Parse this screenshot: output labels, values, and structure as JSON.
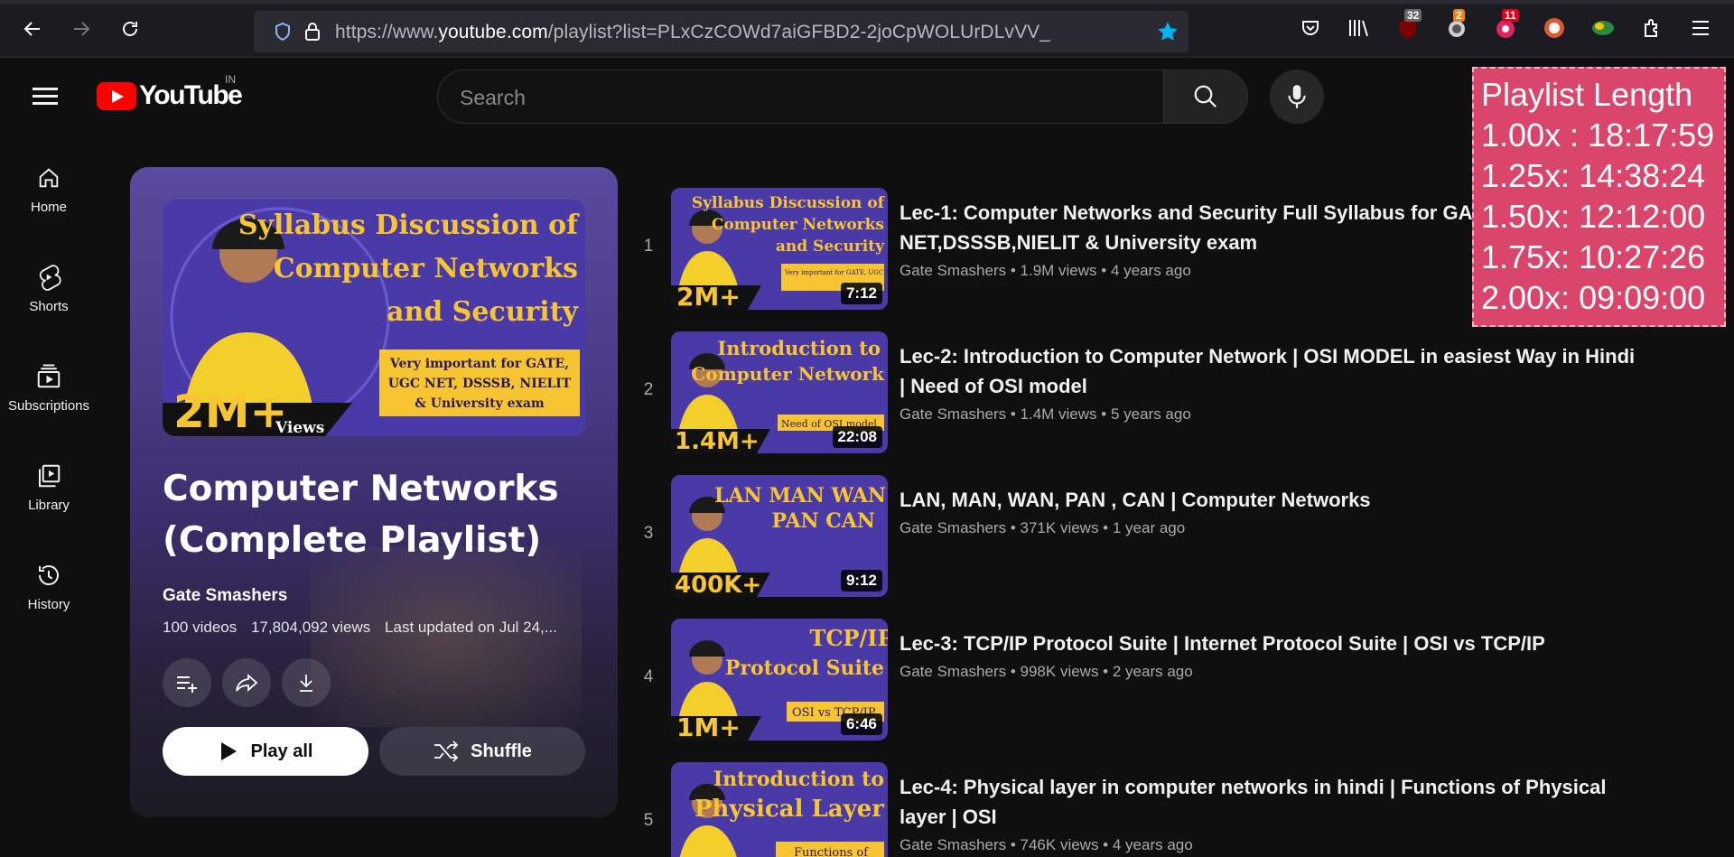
{
  "browser": {
    "url_prefix": "https://www.",
    "url_host": "youtube.com",
    "url_path": "/playlist?list=PLxCzCOWd7aiGFBD2-2joCpWOLUrDLvVV_",
    "badges": [
      "32",
      "2",
      "11"
    ]
  },
  "header": {
    "logo_text": "YouTube",
    "country": "IN",
    "search_placeholder": "Search"
  },
  "playlist_length": {
    "title": "Playlist Length",
    "rows": [
      "1.00x : 18:17:59",
      "1.25x: 14:38:24",
      "1.50x: 12:12:00",
      "1.75x: 10:27:26",
      "2.00x: 09:09:00"
    ]
  },
  "guide": [
    {
      "label": "Home",
      "icon": "home-icon"
    },
    {
      "label": "Shorts",
      "icon": "shorts-icon"
    },
    {
      "label": "Subscriptions",
      "icon": "subscriptions-icon"
    },
    {
      "label": "Library",
      "icon": "library-icon"
    },
    {
      "label": "History",
      "icon": "history-icon"
    }
  ],
  "playlist": {
    "thumb": {
      "line1": "Syllabus Discussion of",
      "line2": "Computer Networks",
      "line3": "and Security",
      "box": [
        "Very important for GATE,",
        "UGC NET, DSSSB, NIELIT",
        "& University exam"
      ],
      "views_big": "2M+",
      "views_small": "Views"
    },
    "title": "Computer Networks (Complete Playlist)",
    "channel": "Gate Smashers",
    "videos": "100 videos",
    "views": "17,804,092 views",
    "updated": "Last updated on Jul 24,...",
    "play_all": "Play all",
    "shuffle": "Shuffle"
  },
  "videos": [
    {
      "index": "1",
      "title": "Lec-1: Computer Networks and Security Full Syllabus for GA... NET,DSSSB,NIELIT & University exam",
      "title_l1": "Lec-1: Computer Networks and Security Full Syllabus for GA",
      "title_l2": "NET,DSSSB,NIELIT & University exam",
      "channel": "Gate Smashers",
      "views": "1.9M views",
      "age": "4 years ago",
      "duration": "7:12",
      "thumb_lines": [
        "Syllabus Discussion of",
        "Computer Networks",
        "and Security"
      ],
      "thumb_box": "Very important for GATE, UGC NET, DSSSB, NIELIT & Univ...",
      "thumb_views": "2M+"
    },
    {
      "index": "2",
      "title_l1": "Lec-2: Introduction to Computer Network | OSI MODEL in easiest Way in Hindi",
      "title_l2": "| Need of OSI model",
      "channel": "Gate Smashers",
      "views": "1.4M views",
      "age": "5 years ago",
      "duration": "22:08",
      "thumb_lines": [
        "Introduction to",
        "Computer Network"
      ],
      "thumb_box": "Need of OSI model",
      "thumb_views": "1.4M+"
    },
    {
      "index": "3",
      "title_l1": "LAN, MAN, WAN, PAN , CAN | Computer Networks",
      "title_l2": "",
      "channel": "Gate Smashers",
      "views": "371K views",
      "age": "1 year ago",
      "duration": "9:12",
      "thumb_lines": [
        "LAN MAN WAN",
        "PAN CAN"
      ],
      "thumb_box": "",
      "thumb_views": "400K+"
    },
    {
      "index": "4",
      "title_l1": "Lec-3: TCP/IP Protocol Suite | Internet Protocol Suite | OSI vs TCP/IP",
      "title_l2": "",
      "channel": "Gate Smashers",
      "views": "998K views",
      "age": "2 years ago",
      "duration": "6:46",
      "thumb_lines": [
        "TCP/IP",
        "Protocol Suite"
      ],
      "thumb_box": "OSI vs TCP/IP",
      "thumb_views": "1M+"
    },
    {
      "index": "5",
      "title_l1": "Lec-4: Physical layer in computer networks in hindi | Functions of Physical",
      "title_l2": "layer | OSI",
      "channel": "Gate Smashers",
      "views": "746K views",
      "age": "4 years ago",
      "duration": "",
      "thumb_lines": [
        "Introduction to",
        "Physical Layer"
      ],
      "thumb_box": "Functions of",
      "thumb_views": ""
    }
  ],
  "colors": {
    "thumb_purple": "#4a3aa8",
    "thumb_yellow": "#f7c531",
    "overlay_pink": "#d9456b"
  }
}
